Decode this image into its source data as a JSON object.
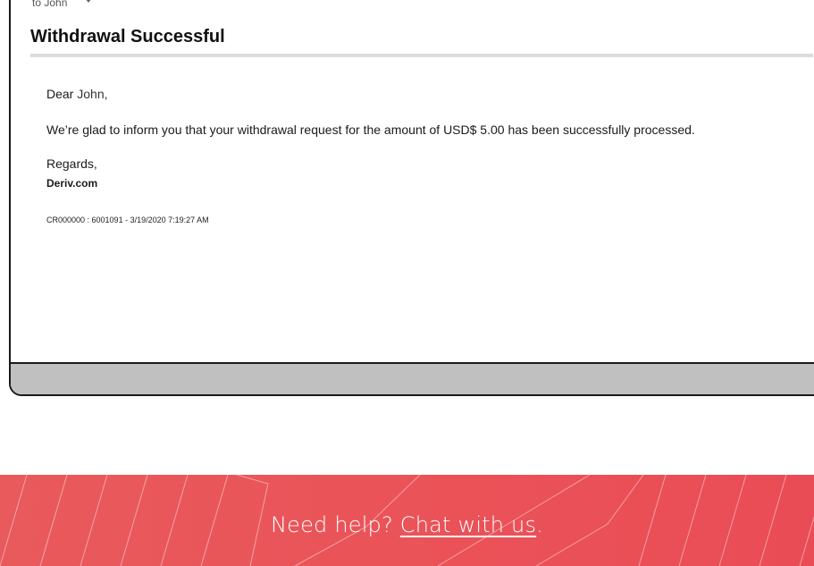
{
  "email": {
    "to_label": "to John",
    "subject": "Withdrawal Successful",
    "greeting_prefix": "Dear",
    "greeting_name": "John,",
    "message": "We’re glad to inform you that your withdrawal request for the amount of USD$ 5.00 has been successfully processed.",
    "regards": "Regards,",
    "signature": "Deriv.com",
    "reference": "CR000000 : 6001091 - 3/19/2020 7:19:27 AM"
  },
  "help_banner": {
    "prompt": "Need help?",
    "link_label": "Chat with us",
    "suffix": ".",
    "background_color": "#ea4c55"
  }
}
